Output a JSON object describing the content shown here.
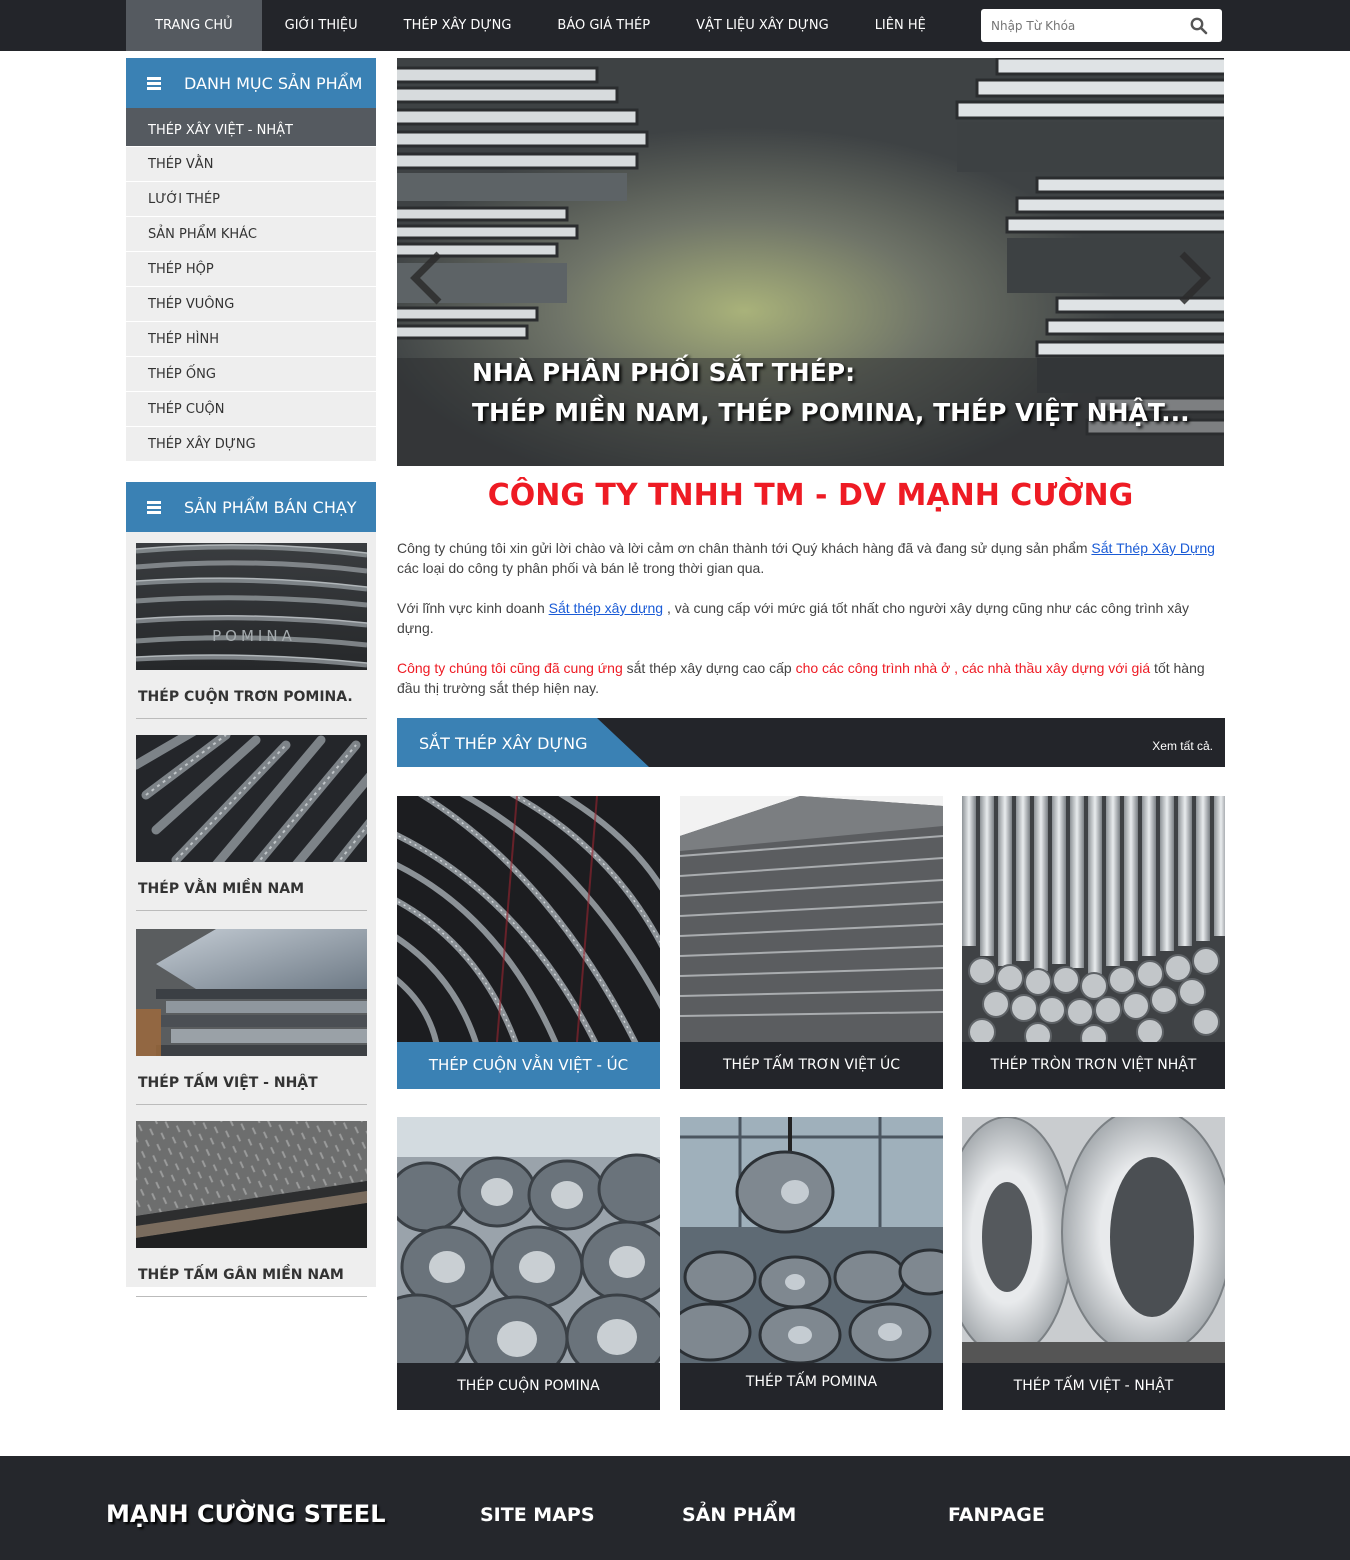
{
  "nav": {
    "items": [
      {
        "label": "TRANG CHỦ",
        "active": true
      },
      {
        "label": "GIỚI THIỆU"
      },
      {
        "label": "THÉP XÂY DỰNG"
      },
      {
        "label": "BÁO GIÁ THÉP"
      },
      {
        "label": "VẬT LIỆU XÂY DỰNG"
      },
      {
        "label": "LIÊN HỆ"
      }
    ],
    "search_placeholder": "Nhập Từ Khóa"
  },
  "sidebar": {
    "categories_title": "DANH MỤC SẢN PHẨM",
    "categories": [
      "THÉP XÂY VIỆT - NHẬT",
      "THÉP VẰN",
      "LƯỚI THÉP",
      "SẢN PHẨM KHÁC",
      "THÉP HỘP",
      "THÉP VUÔNG",
      "THÉP HÌNH",
      "THÉP ỐNG",
      "THÉP CUỘN",
      "THÉP XÂY DỰNG"
    ],
    "bestseller_title": "SẢN PHẨM BÁN CHẠY",
    "bestsellers": [
      {
        "name": "THÉP CUỘN TRƠN POMINA.",
        "img_text": "POMINA"
      },
      {
        "name": "THÉP VẰN MIỀN NAM"
      },
      {
        "name": "THÉP TẤM VIỆT - NHẬT"
      },
      {
        "name": "THÉP TẤM GÂN MIỀN NAM"
      }
    ]
  },
  "slider": {
    "caption_line1": "NHÀ PHÂN PHỐI SẮT THÉP:",
    "caption_line2": "THÉP MIỀN NAM, THÉP POMINA, THÉP VIỆT NHẬT..."
  },
  "intro": {
    "company_name": "CÔNG TY TNHH TM - DV MẠNH CƯỜNG",
    "p1_a": "Công ty chúng tôi xin gửi lời chào và lời cảm ơn chân thành tới Quý khách hàng đã và đang sử dụng sản phẩm ",
    "p1_link": "Sắt Thép Xây Dựng",
    "p1_b": " các loại do công ty  phân phối và bán lẻ trong thời gian qua.",
    "p2_a": "Với lĩnh vực kinh doanh ",
    "p2_link": "Sắt thép xây dựng",
    "p2_b": " , và cung cấp với mức giá tốt nhất cho người xây dựng cũng như các công trình xây dựng.",
    "p3_red1": "Công ty chúng tôi cũng đã cung ứng",
    "p3_mid": " sắt thép xây dựng cao cấp ",
    "p3_red2": "cho các công trình nhà ở , các nhà thầu xây dựng với giá",
    "p3_end": "  tốt hàng đầu thị trường sắt thép hiện nay."
  },
  "section": {
    "title": "SẮT THÉP XÂY DỰNG",
    "view_all": "Xem tất cả."
  },
  "products": [
    {
      "label": "THÉP CUỘN VẰN VIỆT - ÚC",
      "highlight": true
    },
    {
      "label": "THÉP TẤM TRƠN VIỆT ÚC"
    },
    {
      "label": "THÉP TRÒN TRƠN VIỆT NHẬT"
    },
    {
      "label": "THÉP CUỘN POMINA"
    },
    {
      "label": "THÉP TẤM POMINA"
    },
    {
      "label": "THÉP TẤM VIỆT - NHẬT"
    }
  ],
  "footer": {
    "brand": "MẠNH CƯỜNG STEEL",
    "col_sitemaps": "SITE MAPS",
    "col_products": "SẢN PHẨM",
    "col_fanpage": "FANPAGE"
  },
  "colors": {
    "accent_blue": "#3a81b4",
    "dark_bar": "#23252a",
    "company_red": "#ee1b24",
    "link_blue": "#1a5bd6"
  }
}
